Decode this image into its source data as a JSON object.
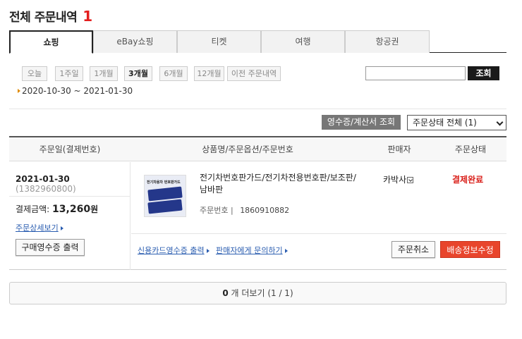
{
  "page": {
    "title": "전체 주문내역",
    "count": "1"
  },
  "tabs": [
    {
      "label": "쇼핑",
      "active": true
    },
    {
      "label": "eBay쇼핑",
      "active": false
    },
    {
      "label": "티켓",
      "active": false
    },
    {
      "label": "여행",
      "active": false
    },
    {
      "label": "항공권",
      "active": false
    }
  ],
  "period_filters": [
    {
      "label": "오늘",
      "active": false
    },
    {
      "label": "1주일",
      "active": false
    },
    {
      "label": "1개월",
      "active": false
    },
    {
      "label": "3개월",
      "active": true
    },
    {
      "label": "6개월",
      "active": false
    },
    {
      "label": "12개월",
      "active": false
    },
    {
      "label": "이전 주문내역",
      "active": false
    }
  ],
  "search": {
    "value": "",
    "button_label": "조회"
  },
  "date_range": "2020-10-30 ~ 2021-01-30",
  "toolbar": {
    "receipt_label": "영수증/계산서 조회",
    "status_select": "주문상태 전체 (1)"
  },
  "table": {
    "headers": [
      "주문일(결제번호)",
      "상품명/주문옵션/주문번호",
      "판매자",
      "주문상태"
    ]
  },
  "order": {
    "date": "2021-01-30",
    "payment_no": "(1382960800)",
    "amount_label": "결제금액:",
    "amount": "13,260",
    "amount_unit": "원",
    "detail_link": "주문상세보기",
    "print_button": "구매영수증 출력",
    "product_thumb_text": "전기차용차 번호판가드",
    "product_name": "전기차번호판가드/전기차전용번호판/보조판/남바판",
    "order_no_label": "주문번호",
    "order_no": "1860910882",
    "seller": "카박사",
    "status": "결제완료",
    "card_receipt_link": "신용카드영수증 출력",
    "seller_inquiry_link": "판매자에게 문의하기",
    "cancel_button": "주문취소",
    "shipping_button": "배송정보수정"
  },
  "more": {
    "count": "0",
    "text": "개 더보기 (1 / 1)"
  },
  "colors": {
    "accent_red": "#e31e1e",
    "status_red": "#d91e18",
    "link_blue": "#2a5db0",
    "shipping_button": "#e8452c"
  }
}
